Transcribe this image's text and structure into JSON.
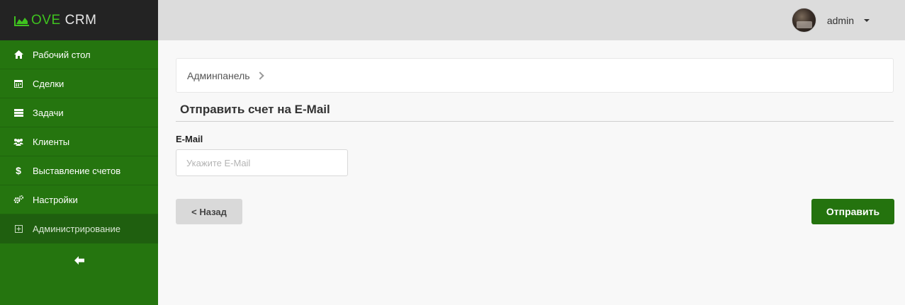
{
  "logo": {
    "brand": "OVE",
    "suffix": "CRM",
    "brand_color": "#3fc21f"
  },
  "sidebar": {
    "items": [
      {
        "label": "Рабочий стол",
        "icon": "home-icon"
      },
      {
        "label": "Сделки",
        "icon": "calendar-icon"
      },
      {
        "label": "Задачи",
        "icon": "tasks-icon"
      },
      {
        "label": "Клиенты",
        "icon": "users-icon"
      },
      {
        "label": "Выставление счетов",
        "icon": "dollar-icon"
      },
      {
        "label": "Настройки",
        "icon": "gears-icon"
      },
      {
        "label": "Администрирование",
        "icon": "admin-icon",
        "active": true
      }
    ],
    "collapse_icon": "arrow-left-icon",
    "bg_color": "#25750f"
  },
  "header": {
    "username": "admin"
  },
  "breadcrumb": {
    "root": "Админпанель"
  },
  "page": {
    "title": "Отправить счет на E-Mail",
    "email_label": "E-Mail",
    "email_placeholder": "Укажите E-Mail",
    "email_value": "",
    "back_label": "< Назад",
    "send_label": "Отправить",
    "accent_color": "#24730e"
  }
}
